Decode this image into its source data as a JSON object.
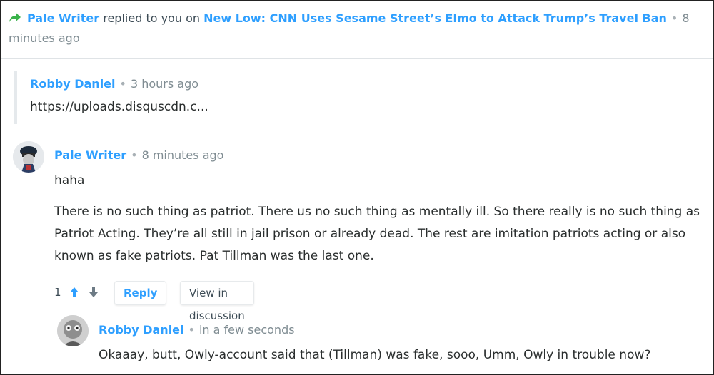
{
  "notification": {
    "icon": "reply-arrow-icon",
    "user": "Pale Writer",
    "action": "replied to you on",
    "article": "New Low: CNN Uses Sesame Street’s Elmo to Attack Trump’s Travel Ban",
    "time": "8 minutes ago"
  },
  "quoted": {
    "author": "Robby Daniel",
    "time": "3 hours ago",
    "text": "https://uploads.disquscdn.c..."
  },
  "comment": {
    "author": "Pale Writer",
    "time": "8 minutes ago",
    "line1": "haha",
    "paragraph": "There is no such thing as patriot. There us no such thing as mentally ill. So there really is no such thing as Patriot Acting. They’re all still in jail prison or already dead. The rest are imitation patriots acting or also known as fake patriots. Pat Tillman was the last one.",
    "votes": "1",
    "reply_label": "Reply",
    "view_label": "View in discussion"
  },
  "draft_reply": {
    "author": "Robby Daniel",
    "time": "in a few seconds",
    "text": "Okaaay, butt, Owly-account said that (Tillman) was fake, sooo, Umm, Owly in trouble now?"
  },
  "colors": {
    "link": "#2e9fff",
    "arrow": "#3ab34a",
    "muted": "#7f8c92"
  }
}
